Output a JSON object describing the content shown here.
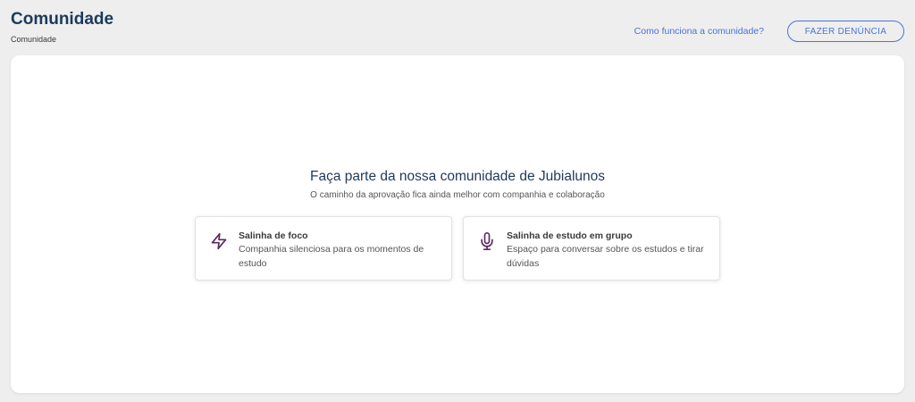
{
  "header": {
    "title": "Comunidade",
    "breadcrumb": "Comunidade",
    "help_link": "Como funciona a comunidade?",
    "report_button": "FAZER DENÚNCIA"
  },
  "main": {
    "heading": "Faça parte da nossa comunidade de Jubialunos",
    "subheading": "O caminho da aprovação fica ainda melhor com companhia e colaboração",
    "rooms": [
      {
        "icon": "lightning-bolt-icon",
        "title": "Salinha de foco",
        "description": "Companhia silenciosa para os momentos de estudo"
      },
      {
        "icon": "microphone-icon",
        "title": "Salinha de estudo em grupo",
        "description": "Espaço para conversar sobre os estudos e tirar dúvidas"
      }
    ]
  },
  "colors": {
    "page_background": "#eeeeee",
    "title": "#1b3a5c",
    "accent": "#4a73d6",
    "icon": "#5a2a5e",
    "card": "#ffffff"
  }
}
